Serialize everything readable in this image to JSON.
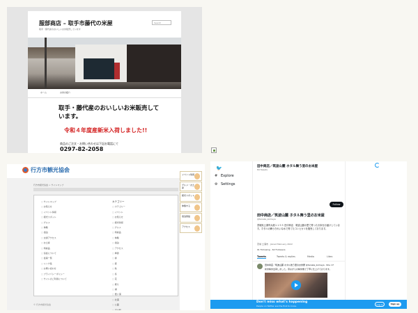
{
  "panel1": {
    "site_title": "服部商店 – 取手市藤代の米屋",
    "site_description": "取手・藤代産のおいしいお米販売しています",
    "search_placeholder": "Search",
    "nav": [
      "ホーム",
      "お米の紹介"
    ],
    "headline": "取手・藤代産のおいしいお米販売しています。",
    "notice": "令和４年度産新米入荷しました!!",
    "contact_label": "商品のご注文・お問い合わせは下記お電話にて",
    "phone": "0297-82-2058"
  },
  "panel2": {
    "brand": "行方市観光協会",
    "breadcrumb": "行方市観光協会 > サイトマップ",
    "left_column": {
      "heading": "",
      "items": [
        "サイトマップ",
        "お知らせ",
        "イベント情報",
        "観光スポット",
        "グルメ",
        "体験",
        "宿泊",
        "交通アクセス",
        "お土産",
        "特産品",
        "協会について",
        "会員一覧",
        "リンク集",
        "お問い合わせ",
        "プライバシーポリシー",
        "サイトのご利用について"
      ]
    },
    "right_column": {
      "heading": "カテゴリー",
      "items": [
        "カテゴリー",
        "イベント",
        "お知らせ",
        "観光情報",
        "グルメ",
        "特産品",
        "体験",
        "宿泊",
        "アクセス",
        "季節",
        "春",
        "夏",
        "秋",
        "冬",
        "花",
        "祭り",
        "湖",
        "霞ヶ浦",
        "北浦",
        "公園",
        "道の駅",
        "直売所",
        "その他"
      ]
    },
    "side_tiles": [
      "イベント情報",
      "グルメ・お土産",
      "観光スポット",
      "体験する",
      "宿泊施設",
      "アクセス"
    ],
    "footer": "© 行方市観光協会"
  },
  "panel3": {
    "header_name": "田中商店／筑波山麓 ホタル舞う里のお米屋",
    "header_sub": "84 Tweets",
    "nav": [
      {
        "icon": "#",
        "label": "Explore"
      },
      {
        "icon": "⚙",
        "label": "Settings"
      }
    ],
    "follow_label": "Follow",
    "profile_name": "田中商店／筑波山麓 ホタル舞う里のお米屋",
    "handle": "@tanaka_komeya",
    "bio": "茨城県土浦市大畑１１５５ 田中商店　筑波山麓の里で育ったお米をお届けしています。ホタルの舞うきれいな水で育てたコシヒカリを販売しております。",
    "meta": "茨城 土浦市 · Joined February 2022",
    "counts": "91 Following · 62 Followers",
    "tabs": [
      "Tweets",
      "Tweets & replies",
      "Media",
      "Likes"
    ],
    "tweet_head": "田中商店／筑波山麓 ホタル舞う里のお米屋 @tanaka_komeya · Nov 17",
    "tweet_body": "新米精米出荷しました。昔ながらの精米機で丁寧に仕上げております。",
    "bottom_title": "Don't miss what's happening",
    "bottom_sub": "People on Twitter are the first to know.",
    "login_label": "Log in",
    "signup_label": "Sign up",
    "accent": "#1d9bf0"
  }
}
